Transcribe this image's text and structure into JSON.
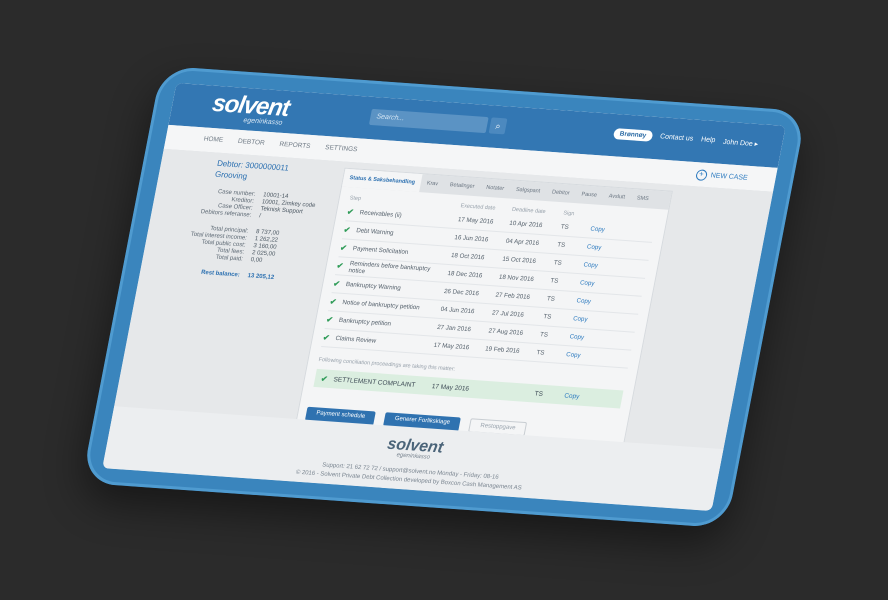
{
  "brand": {
    "logo": "solvent",
    "tagline": "egeninkasso"
  },
  "search": {
    "placeholder": "Search..."
  },
  "topnav": {
    "pill": "Brønnøy",
    "contact": "Contact us",
    "help": "Help",
    "user": "John Doe ▸"
  },
  "menu": [
    "HOME",
    "DEBTOR",
    "REPORTS",
    "SETTINGS"
  ],
  "new_case": "NEW CASE",
  "debtor": {
    "title": "Debtor: 3000000011",
    "name": "Grooving",
    "fields": [
      {
        "k": "Case number:",
        "v": "10001-14"
      },
      {
        "k": "Kreditor:",
        "v": "10001, Zimkey code"
      },
      {
        "k": "Case Officer:",
        "v": "Teknisk Support"
      },
      {
        "k": "Debitors referanse:",
        "v": "/"
      }
    ],
    "totals": [
      {
        "k": "Total principal:",
        "v": "8 737,00"
      },
      {
        "k": "Total interest income:",
        "v": "1 262,22"
      },
      {
        "k": "Total public cost:",
        "v": "3 160,00"
      },
      {
        "k": "Total fees:",
        "v": "2 025,00"
      },
      {
        "k": "Total paid:",
        "v": "0,00"
      }
    ],
    "rest_balance": {
      "k": "Rest balance:",
      "v": "13 205,12"
    }
  },
  "tabs": [
    "Status & Saksbehandling",
    "Krav",
    "Betalinger",
    "Notater",
    "Salgspant",
    "Debitor",
    "Pause",
    "Avslutt",
    "SMS"
  ],
  "table": {
    "headers": [
      "Step",
      "Executed date",
      "Deadline date",
      "Sign",
      ""
    ],
    "rows": [
      {
        "step": "Receivables (ii)",
        "executed": "17 May 2016",
        "deadline": "10 Apr 2016",
        "sign": "TS",
        "action": "Copy"
      },
      {
        "step": "Debt Warning",
        "executed": "16 Jun 2016",
        "deadline": "04 Apr 2016",
        "sign": "TS",
        "action": "Copy"
      },
      {
        "step": "Payment Solicitation",
        "executed": "18 Oct 2016",
        "deadline": "15 Oct 2016",
        "sign": "TS",
        "action": "Copy"
      },
      {
        "step": "Reminders before bankruptcy notice",
        "executed": "18 Dec 2016",
        "deadline": "18 Nov 2016",
        "sign": "TS",
        "action": "Copy"
      },
      {
        "step": "Bankruptcy Warning",
        "executed": "26 Dec 2016",
        "deadline": "27 Feb 2016",
        "sign": "TS",
        "action": "Copy"
      },
      {
        "step": "Notice of bankruptcy petition",
        "executed": "04 Jun 2016",
        "deadline": "27 Jul 2016",
        "sign": "TS",
        "action": "Copy"
      },
      {
        "step": "Bankruptcy petition",
        "executed": "27 Jan 2016",
        "deadline": "27 Aug 2016",
        "sign": "TS",
        "action": "Copy"
      },
      {
        "step": "Claims Review",
        "executed": "17 May 2016",
        "deadline": "19 Feb 2016",
        "sign": "TS",
        "action": "Copy"
      }
    ],
    "note": "Following conciliation proceedings are taking this matter:",
    "settlement": {
      "step": "SETTLEMENT COMPLAINT",
      "executed": "17 May 2016",
      "sign": "TS",
      "action": "Copy"
    }
  },
  "buttons": {
    "schedule": "Payment schedule",
    "forliksklage": "Generer Forliksklage",
    "restoppgave": "Restoppgave"
  },
  "footer": {
    "logo": "solvent",
    "tagline": "egeninkasso",
    "support": "Support: 21 62 72 72 / support@solvent.no Monday - Friday: 08-16",
    "copyright": "© 2016 - Solvent Private Debt Collection developed by Boxcon Cash Management AS"
  }
}
